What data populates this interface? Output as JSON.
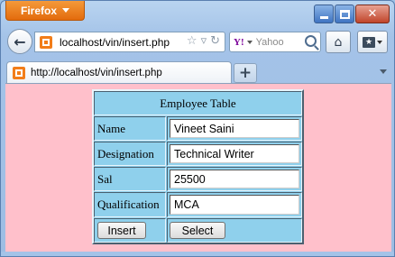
{
  "browser": {
    "app_button_label": "Firefox",
    "url": "localhost/vin/insert.php",
    "search_placeholder": "Yahoo",
    "search_engine_logo": "Y!",
    "tab_title": "http://localhost/vin/insert.php",
    "new_tab_label": "+"
  },
  "icons": {
    "back": "arrow-left-icon",
    "bookmark_star": "star-icon",
    "reload": "reload-icon",
    "home": "home-icon",
    "bookmarks": "bookmarks-icon",
    "favicon": "page-favicon-icon"
  },
  "colors": {
    "page_background": "#ffc0cb",
    "table_background": "#8fd0ec",
    "firefox_button": "#e36b0d"
  },
  "form": {
    "caption": "Employee Table",
    "rows": [
      {
        "label": "Name",
        "value": "Vineet Saini"
      },
      {
        "label": "Designation",
        "value": "Technical Writer"
      },
      {
        "label": "Sal",
        "value": "25500"
      },
      {
        "label": "Qualification",
        "value": "MCA"
      }
    ],
    "insert_label": "Insert",
    "select_label": "Select"
  }
}
